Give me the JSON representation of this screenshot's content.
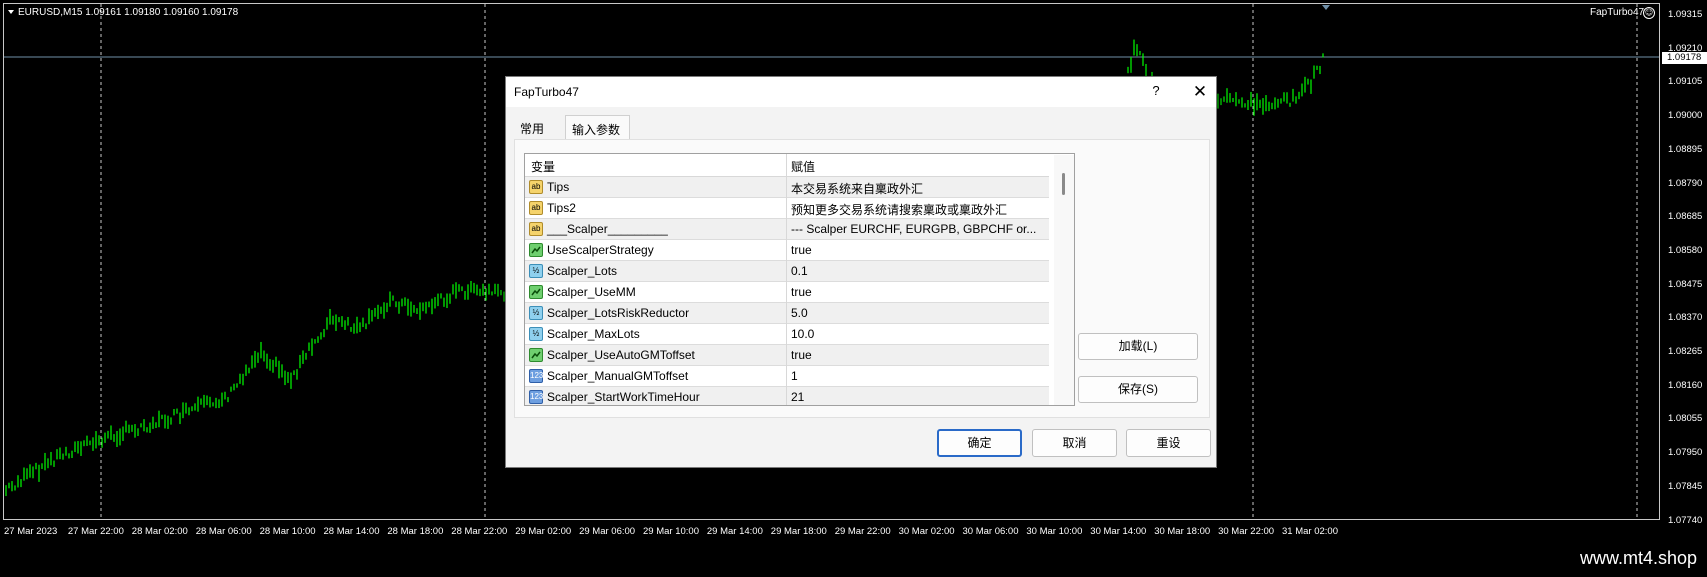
{
  "chart": {
    "symbol_info": "EURUSD,M15  1.09161 1.09180 1.09160 1.09178",
    "ea_label": "FapTurbo47",
    "current_price": "1.09178",
    "price_labels": [
      "1.09315",
      "1.09210",
      "1.09105",
      "1.09000",
      "1.08895",
      "1.08790",
      "1.08685",
      "1.08580",
      "1.08475",
      "1.08370",
      "1.08265",
      "1.08160",
      "1.08055",
      "1.07950",
      "1.07845",
      "1.07740"
    ],
    "time_labels": [
      "27 Mar 2023",
      "27 Mar 22:00",
      "28 Mar 02:00",
      "28 Mar 06:00",
      "28 Mar 10:00",
      "28 Mar 14:00",
      "28 Mar 18:00",
      "28 Mar 22:00",
      "29 Mar 02:00",
      "29 Mar 06:00",
      "29 Mar 10:00",
      "29 Mar 14:00",
      "29 Mar 18:00",
      "29 Mar 22:00",
      "30 Mar 02:00",
      "30 Mar 06:00",
      "30 Mar 10:00",
      "30 Mar 14:00",
      "30 Mar 18:00",
      "30 Mar 22:00",
      "31 Mar 02:00"
    ],
    "colors": {
      "background": "#000000",
      "candles": "#00ff00",
      "grid": "#c8c8c8",
      "price_line": "#6f8fa8"
    }
  },
  "dialog": {
    "title": "FapTurbo47",
    "help": "?",
    "close": "✕",
    "tabs": [
      "常用",
      "输入参数"
    ],
    "table": {
      "headers": [
        "变量",
        "赋值"
      ],
      "rows": [
        {
          "type": "ab",
          "icon": "ab",
          "name": "Tips",
          "value": "本交易系统来自稟政外汇"
        },
        {
          "type": "ab",
          "icon": "ab",
          "name": "Tips2",
          "value": "预知更多交易系统请搜索稟政或稟政外汇"
        },
        {
          "type": "ab",
          "icon": "ab",
          "name": "___Scalper_________",
          "value": "--- Scalper EURCHF, EURGPB, GBPCHF or..."
        },
        {
          "type": "bool",
          "icon": "",
          "name": "UseScalperStrategy",
          "value": "true"
        },
        {
          "type": "dbl",
          "icon": "½",
          "name": "Scalper_Lots",
          "value": "0.1"
        },
        {
          "type": "bool",
          "icon": "",
          "name": "Scalper_UseMM",
          "value": "true"
        },
        {
          "type": "dbl",
          "icon": "½",
          "name": "Scalper_LotsRiskReductor",
          "value": "5.0"
        },
        {
          "type": "dbl",
          "icon": "½",
          "name": "Scalper_MaxLots",
          "value": "10.0"
        },
        {
          "type": "bool",
          "icon": "",
          "name": "Scalper_UseAutoGMToffset",
          "value": "true"
        },
        {
          "type": "int",
          "icon": "123",
          "name": "Scalper_ManualGMToffset",
          "value": "1"
        },
        {
          "type": "int",
          "icon": "123",
          "name": "Scalper_StartWorkTimeHour",
          "value": "21"
        }
      ]
    },
    "load_label": "加载(L)",
    "save_label": "保存(S)",
    "ok_label": "确定",
    "cancel_label": "取消",
    "reset_label": "重设"
  },
  "watermark": "www.mt4.shop"
}
